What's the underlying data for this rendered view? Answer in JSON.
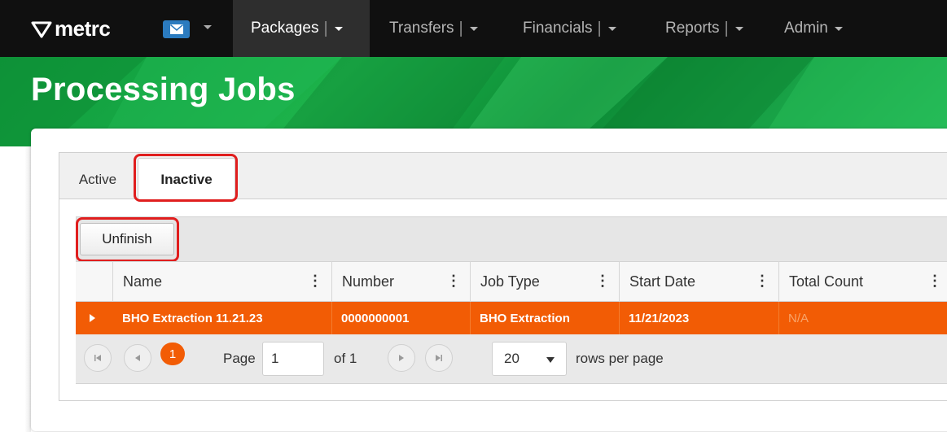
{
  "app": {
    "logo_text": "metrc"
  },
  "nav": {
    "items": [
      {
        "label": "Packages"
      },
      {
        "label": "Transfers"
      },
      {
        "label": "Financials"
      },
      {
        "label": "Reports"
      },
      {
        "label": "Admin"
      }
    ],
    "separator": "|"
  },
  "page": {
    "title": "Processing Jobs"
  },
  "tabs": [
    {
      "label": "Active"
    },
    {
      "label": "Inactive",
      "selected": true
    }
  ],
  "toolbar": {
    "unfinish_label": "Unfinish"
  },
  "grid": {
    "columns": [
      "Name",
      "Number",
      "Job Type",
      "Start Date",
      "Total Count"
    ],
    "column_menu_glyph": "⋮",
    "rows": [
      {
        "name": "BHO Extraction 11.21.23",
        "number": "0000000001",
        "job_type": "BHO Extraction",
        "start_date": "11/21/2023",
        "total_count": "N/A"
      }
    ]
  },
  "pager": {
    "current_page": "1",
    "page_label": "Page",
    "page_input": "1",
    "of_label": "of 1",
    "rows_per_page": "20",
    "rows_per_page_label": "rows per page"
  },
  "colors": {
    "nav_bg": "#101010",
    "brand_green": "#1cb24a",
    "selected_row": "#f25c05",
    "highlight": "#e01e1e",
    "mail_blue": "#2b7bbf"
  }
}
